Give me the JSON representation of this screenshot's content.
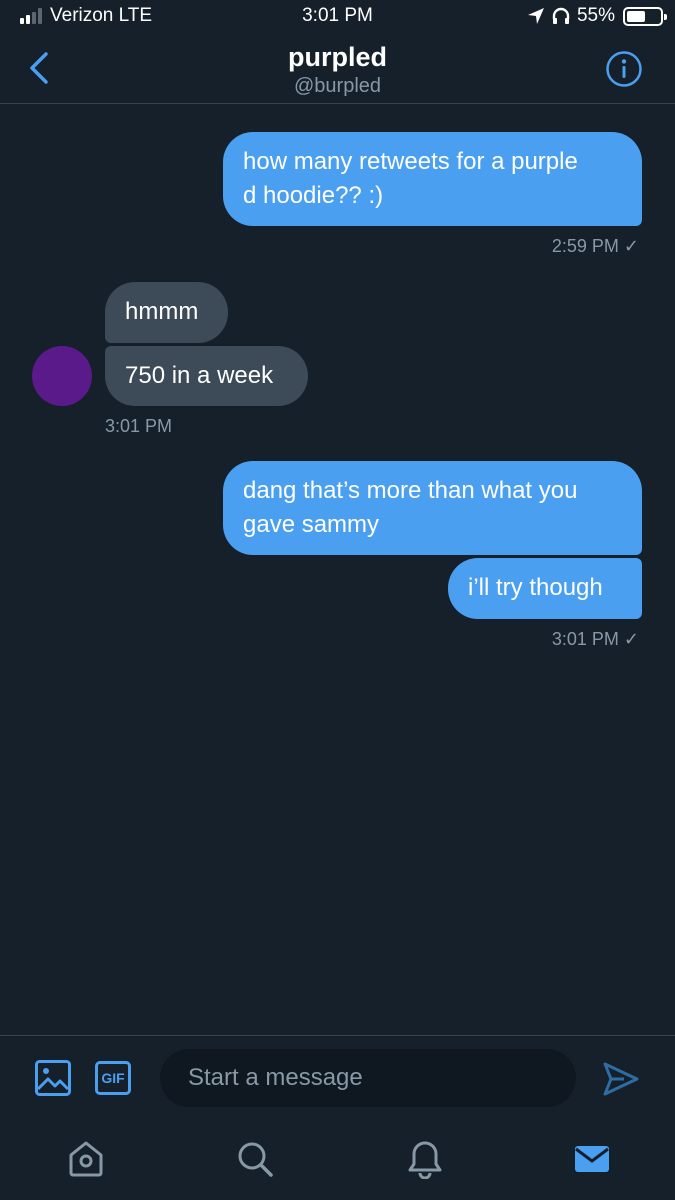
{
  "status_bar": {
    "carrier": "Verizon LTE",
    "time": "3:01 PM",
    "battery": "55%",
    "battery_level": 0.55,
    "icons": [
      "location-icon",
      "headphones-icon"
    ]
  },
  "header": {
    "title": "purpled",
    "handle": "@burpled",
    "icons": [
      "back-chevron-icon",
      "info-icon"
    ]
  },
  "messages": [
    {
      "direction": "outgoing",
      "lines": [
        "how many retweets for a purple",
        "d hoodie?? :)"
      ],
      "time": "2:59 PM ✓"
    },
    {
      "direction": "incoming",
      "lines": [
        "hmmm"
      ]
    },
    {
      "direction": "incoming",
      "lines": [
        "750 in a week"
      ],
      "time": "3:01 PM"
    },
    {
      "direction": "outgoing",
      "lines": [
        "dang that’s more than what you",
        "gave sammy"
      ]
    },
    {
      "direction": "outgoing",
      "lines": [
        "i’ll try though"
      ],
      "time": "3:01 PM ✓"
    }
  ],
  "composer": {
    "placeholder": "Start a message",
    "gif_label": "GIF",
    "icons": [
      "image-icon",
      "gif-icon",
      "send-icon"
    ]
  },
  "tab_bar": {
    "tabs": [
      "home-icon",
      "search-icon",
      "notifications-icon",
      "messages-icon"
    ],
    "active": "messages-icon"
  },
  "colors": {
    "background": "#15202b",
    "accent": "#4a9ff0",
    "incoming_bubble": "#3d4a58",
    "secondary_text": "#8899a6",
    "avatar": "#5a1a8a"
  }
}
